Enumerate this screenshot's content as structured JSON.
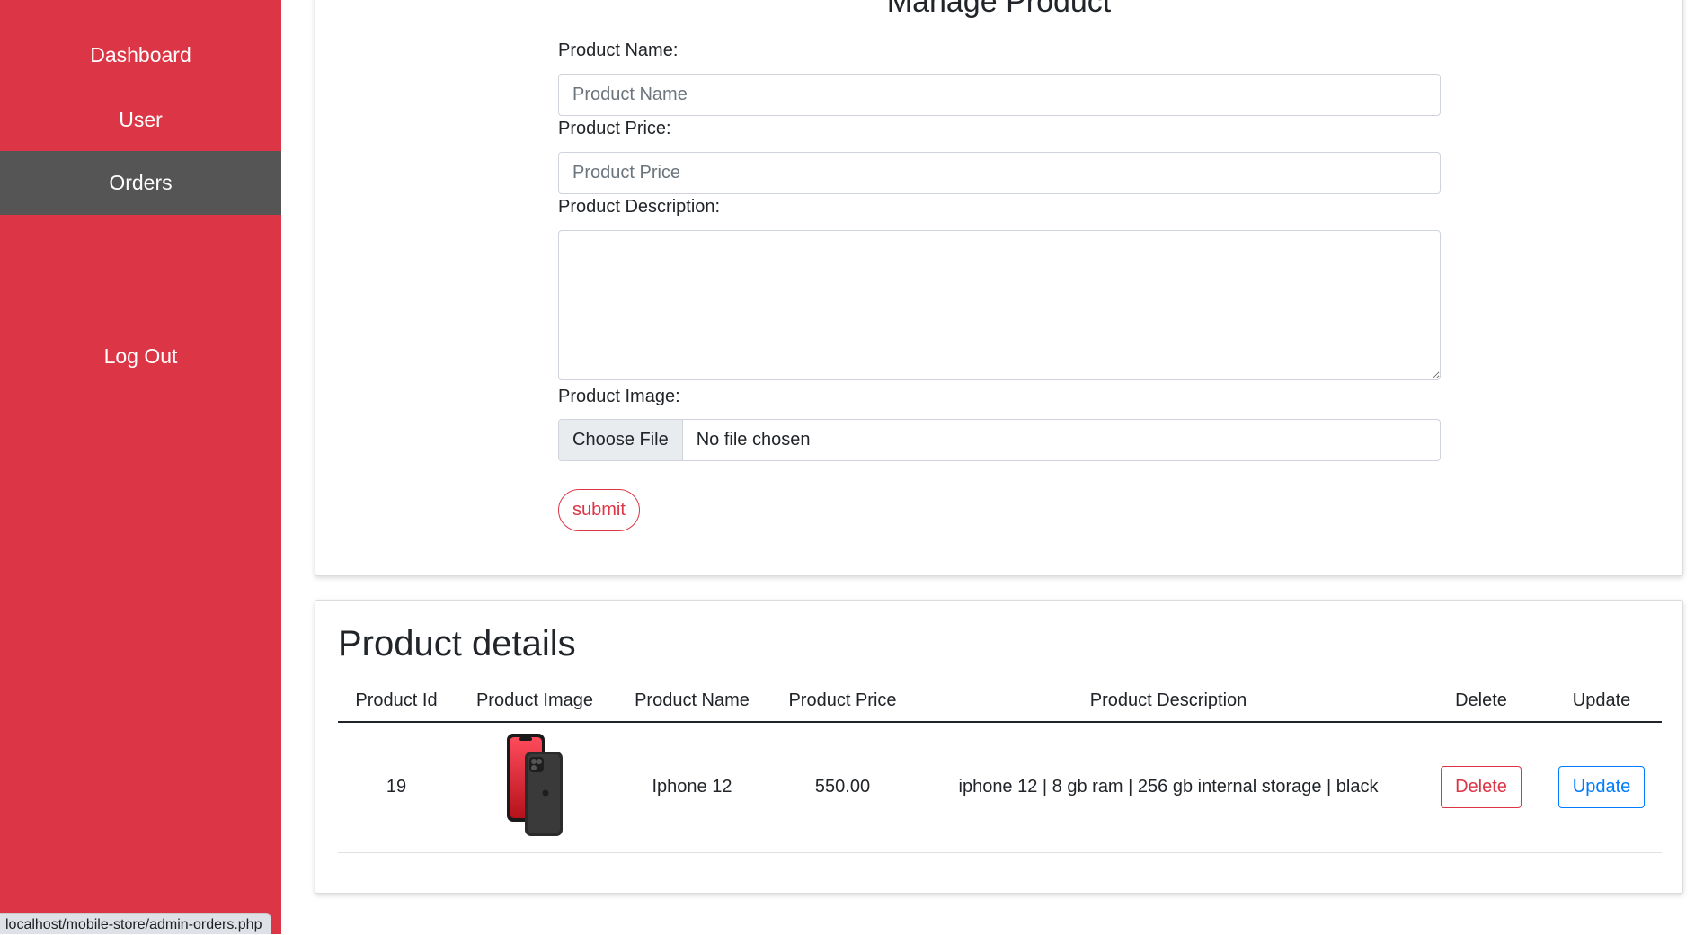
{
  "sidebar": {
    "items": [
      {
        "label": "Dashboard"
      },
      {
        "label": "User"
      },
      {
        "label": "Orders"
      },
      {
        "label": "Log Out"
      }
    ],
    "active_item": "Orders",
    "bg_color": "#dc3545",
    "active_color": "#555555"
  },
  "status_bar": {
    "url": "localhost/mobile-store/admin-orders.php"
  },
  "form": {
    "title": "Manage Product",
    "name_label": "Product Name:",
    "name_placeholder": "Product Name",
    "name_value": "",
    "price_label": "Product Price:",
    "price_placeholder": "Product Price",
    "price_value": "",
    "description_label": "Product Description:",
    "description_value": "",
    "image_label": "Product Image:",
    "file_button": "Choose File",
    "file_status": "No file chosen",
    "submit_label": "submit"
  },
  "details": {
    "title": "Product details",
    "columns": [
      "Product Id",
      "Product Image",
      "Product Name",
      "Product Price",
      "Product Description",
      "Delete",
      "Update"
    ],
    "rows": [
      {
        "id": "19",
        "image": "phone-image",
        "name": "Iphone 12",
        "price": "550.00",
        "description": "iphone 12 | 8 gb ram | 256 gb internal storage | black",
        "delete_label": "Delete",
        "update_label": "Update"
      }
    ]
  },
  "colors": {
    "danger": "#dc3545",
    "primary": "#007bff"
  }
}
